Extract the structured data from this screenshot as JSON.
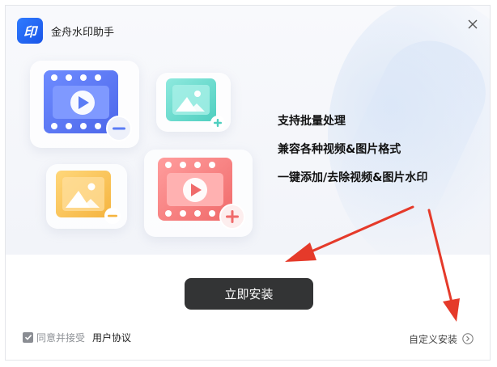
{
  "app": {
    "logo_text": "印",
    "title": "金舟水印助手"
  },
  "features": [
    "支持批量处理",
    "兼容各种视频&图片格式",
    "一键添加/去除视频&图片水印"
  ],
  "install_button": "立即安装",
  "agreement": {
    "checked": true,
    "text": "同意并接受",
    "link": "用户协议"
  },
  "custom_install": "自定义安装",
  "colors": {
    "brand_blue": "#1f63f0",
    "button_dark": "#333435",
    "annotation_arrow": "#e53a2a",
    "video_blue": "#5a7cf5",
    "image_teal": "#5fd6c8",
    "image_yellow": "#f7c45a",
    "video_red": "#f47a7a"
  },
  "icons": {
    "close": "close-icon",
    "video_remove": "video-remove-icon",
    "image_add": "image-add-icon",
    "image_remove": "image-remove-icon",
    "video_add": "video-add-icon",
    "custom_install_arrow": "arrow-right-circle-icon"
  }
}
